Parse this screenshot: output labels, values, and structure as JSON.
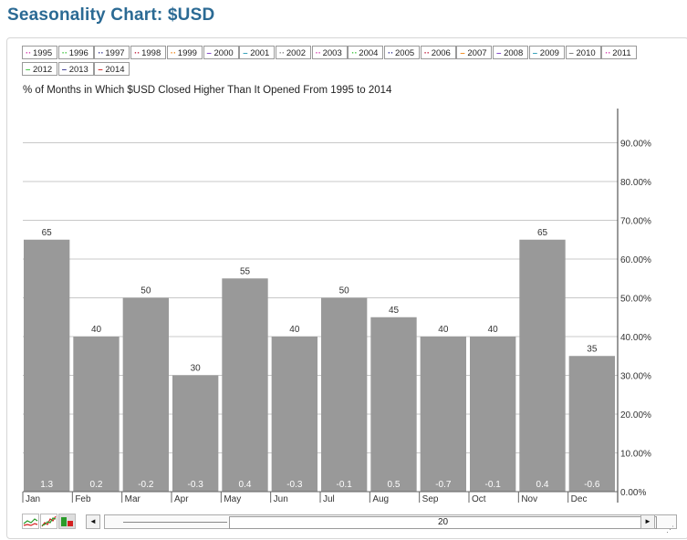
{
  "page": {
    "title": "Seasonality Chart: $USD"
  },
  "legend": {
    "items": [
      {
        "label": "1995",
        "color": "#d63fb0"
      },
      {
        "label": "1996",
        "color": "#3cc43c"
      },
      {
        "label": "1997",
        "color": "#33338f"
      },
      {
        "label": "1998",
        "color": "#c0203f"
      },
      {
        "label": "1999",
        "color": "#f08a1c"
      },
      {
        "label": "2000",
        "color": "#7a3fc6"
      },
      {
        "label": "2001",
        "color": "#2a9bb5"
      },
      {
        "label": "2002",
        "color": "#888888"
      },
      {
        "label": "2003",
        "color": "#d63fb0"
      },
      {
        "label": "2004",
        "color": "#3cc43c"
      },
      {
        "label": "2005",
        "color": "#33338f"
      },
      {
        "label": "2006",
        "color": "#c0203f"
      },
      {
        "label": "2007",
        "color": "#f08a1c"
      },
      {
        "label": "2008",
        "color": "#7a3fc6"
      },
      {
        "label": "2009",
        "color": "#2a9bb5"
      },
      {
        "label": "2010",
        "color": "#777777"
      },
      {
        "label": "2011",
        "color": "#d63fb0"
      },
      {
        "label": "2012",
        "color": "#3cc43c"
      },
      {
        "label": "2013",
        "color": "#33338f"
      },
      {
        "label": "2014",
        "color": "#d42020"
      }
    ]
  },
  "chart_data": {
    "type": "bar",
    "title": "% of Months in Which $USD Closed Higher Than It Opened From 1995 to 2014",
    "categories": [
      "Jan",
      "Feb",
      "Mar",
      "Apr",
      "May",
      "Jun",
      "Jul",
      "Aug",
      "Sep",
      "Oct",
      "Nov",
      "Dec"
    ],
    "values": [
      65,
      40,
      50,
      30,
      55,
      40,
      50,
      45,
      40,
      40,
      65,
      35
    ],
    "avg_change_labels": [
      "1.3",
      "0.2",
      "-0.2",
      "-0.3",
      "0.4",
      "-0.3",
      "-0.1",
      "0.5",
      "-0.7",
      "-0.1",
      "0.4",
      "-0.6"
    ],
    "y_ticks": [
      "0.00%",
      "10.00%",
      "20.00%",
      "30.00%",
      "40.00%",
      "50.00%",
      "60.00%",
      "70.00%",
      "80.00%",
      "90.00%"
    ],
    "ylim": [
      0,
      100
    ],
    "y_axis_position": "right",
    "grid": true,
    "bar_color": "#999999",
    "grid_color": "#c8c8c8"
  },
  "toolbar": {
    "icons": [
      "line-chart-icon",
      "performance-chart-icon",
      "bar-chart-icon"
    ],
    "scroll_left": "◄",
    "scroll_right": "►",
    "range_value": "20"
  }
}
